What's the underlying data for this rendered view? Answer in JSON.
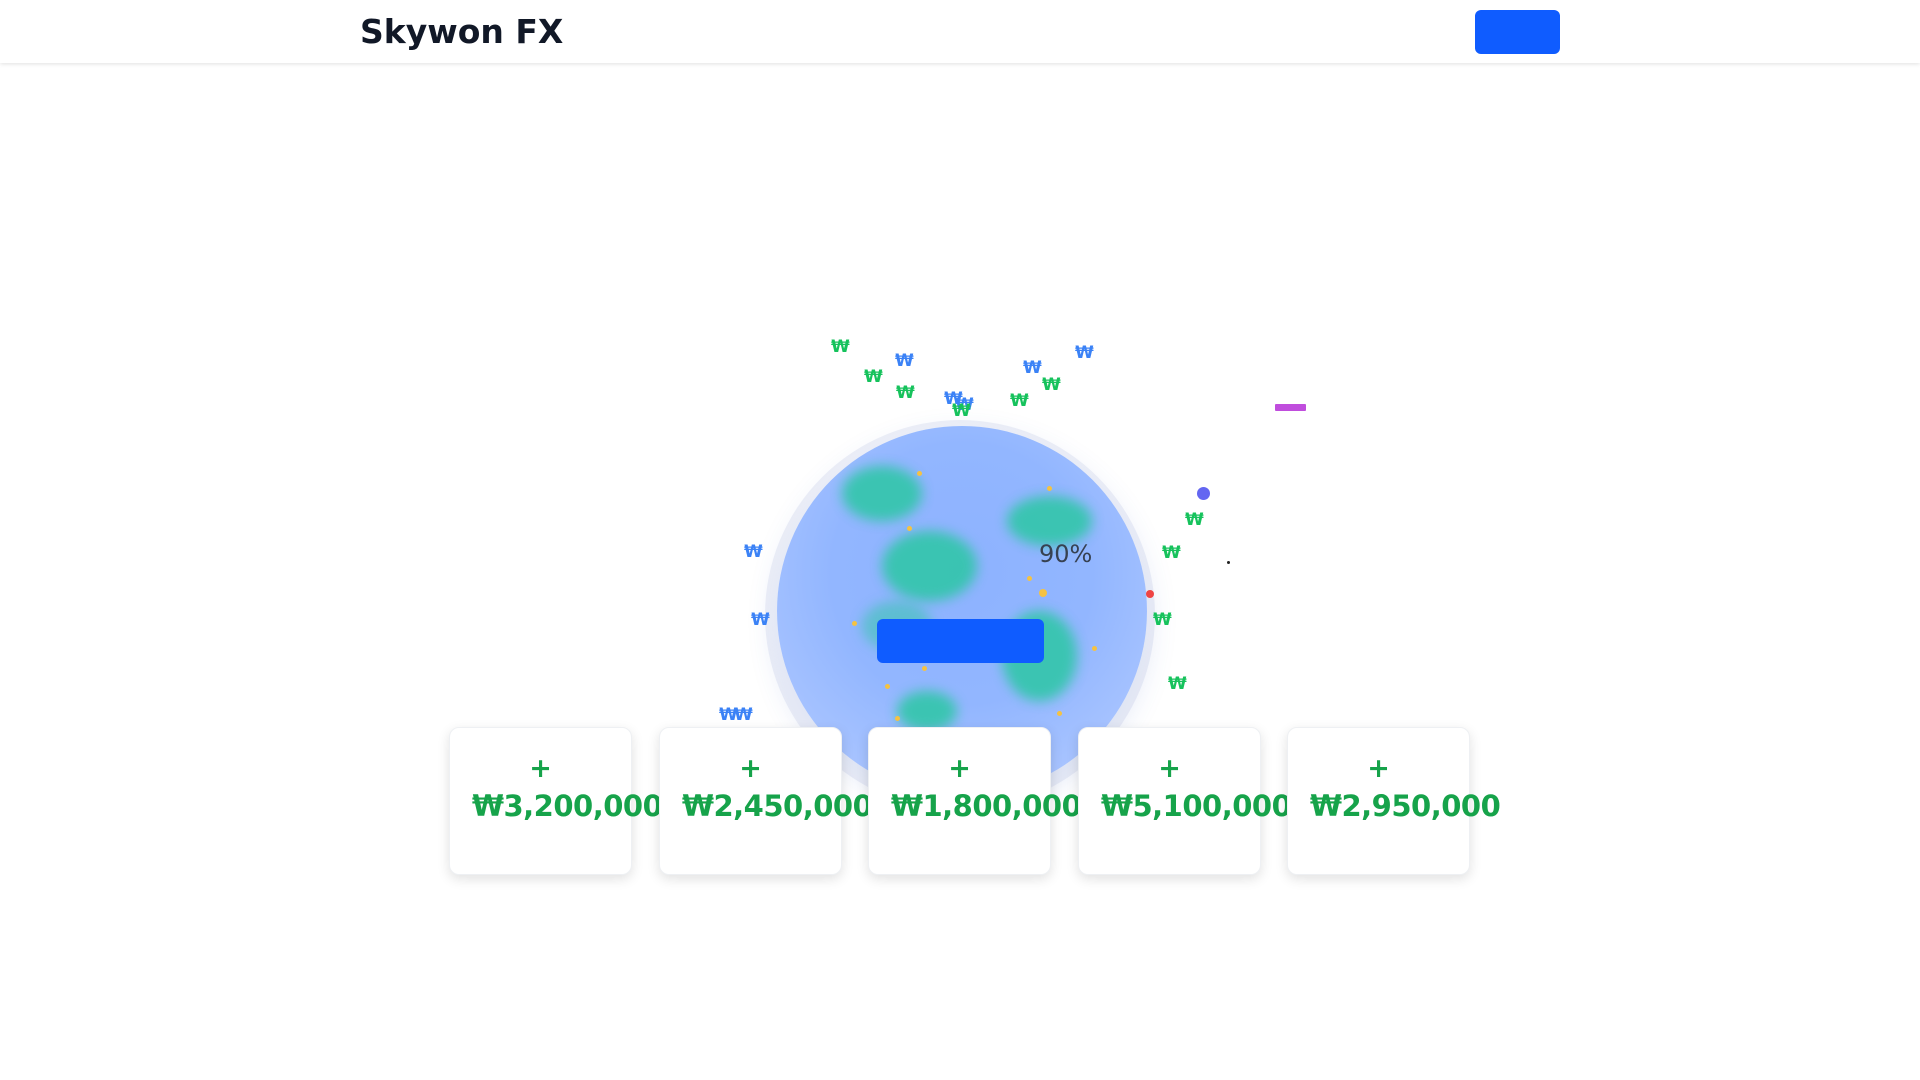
{
  "header": {
    "brand": "Skywon FX",
    "action_button_label": ""
  },
  "hero": {
    "percent": "90%",
    "primary_button_label": ""
  },
  "currency_symbol": "₩",
  "cards": [
    {
      "sign": "+",
      "amount": "₩3,200,000"
    },
    {
      "sign": "+",
      "amount": "₩2,450,000"
    },
    {
      "sign": "+",
      "amount": "₩1,800,000"
    },
    {
      "sign": "+",
      "amount": "₩5,100,000"
    },
    {
      "sign": "+",
      "amount": "₩2,950,000"
    }
  ],
  "colors": {
    "brand_text": "#111827",
    "primary": "#0f5cff",
    "gain_green": "#16a34a",
    "won_green": "#16c25c",
    "won_blue": "#3b82f6",
    "globe_blue": "#92b6ff",
    "land_teal": "#2cc7a5"
  }
}
